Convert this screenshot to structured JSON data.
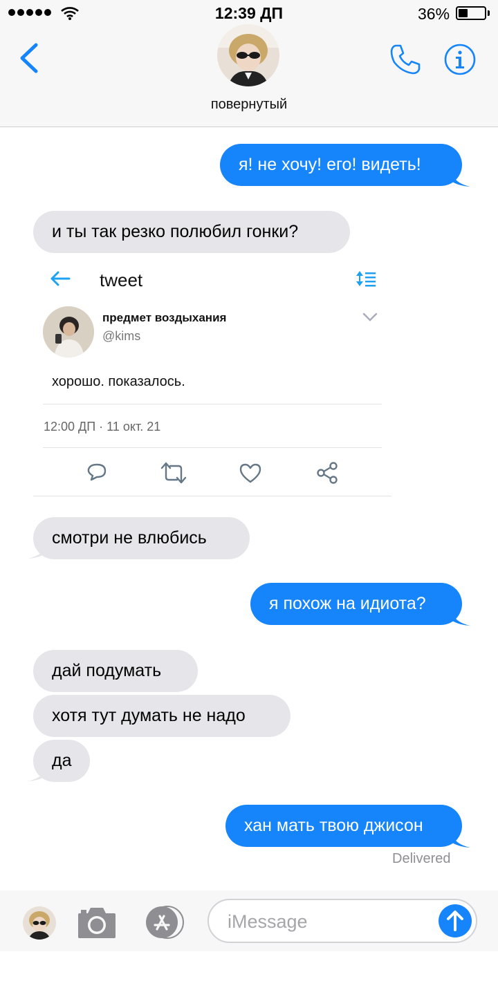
{
  "status_bar": {
    "time": "12:39 ДП",
    "battery": "36%",
    "battery_level": 0.36
  },
  "header": {
    "contact_name": "повернутый"
  },
  "messages": [
    {
      "dir": "out",
      "text": "я! не хочу! его! видеть!"
    },
    {
      "dir": "in",
      "text": "и ты так резко полюбил гонки?"
    },
    {
      "dir": "in",
      "text": "смотри не влюбись"
    },
    {
      "dir": "out",
      "text": "я похож на идиота?"
    },
    {
      "dir": "in",
      "text": "дай подумать"
    },
    {
      "dir": "in",
      "text": "хотя тут думать не надо"
    },
    {
      "dir": "in",
      "text": "да"
    },
    {
      "dir": "out",
      "text": "хан мать твою джисон"
    }
  ],
  "tweet": {
    "title": "tweet",
    "author_name": "предмет воздыхания",
    "handle": "@kims",
    "text": "хорошо. показалось.",
    "meta": "12:00 ДП · 11 окт. 21",
    "actions": [
      "reply-icon",
      "retweet-icon",
      "like-icon",
      "share-icon"
    ]
  },
  "delivered": "Delivered",
  "input": {
    "placeholder": "iMessage"
  },
  "colors": {
    "accent": "#1685fb",
    "incoming": "#e6e5ea",
    "bar": "#f7f7f7"
  }
}
